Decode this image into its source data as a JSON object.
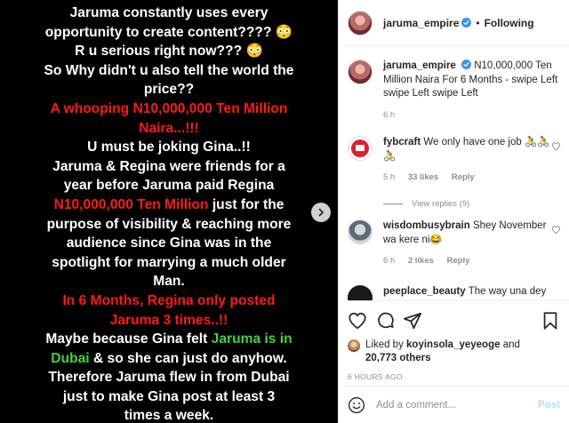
{
  "media": {
    "lines": [
      {
        "segments": [
          {
            "text": "Jaruma constantly uses every",
            "color": "white"
          }
        ]
      },
      {
        "segments": [
          {
            "text": "opportunity to create content???? 😳",
            "color": "white"
          }
        ]
      },
      {
        "segments": [
          {
            "text": "R u serious right now??? 😳",
            "color": "white"
          }
        ]
      },
      {
        "segments": [
          {
            "text": "So Why didn't u also tell the world the",
            "color": "white"
          }
        ]
      },
      {
        "segments": [
          {
            "text": "price??",
            "color": "white"
          }
        ]
      },
      {
        "segments": [
          {
            "text": "A whooping N10,000,000 Ten Million",
            "color": "red"
          }
        ]
      },
      {
        "segments": [
          {
            "text": "Naira...!!!",
            "color": "red"
          }
        ]
      },
      {
        "segments": [
          {
            "text": "U must be joking Gina..!!",
            "color": "white"
          }
        ]
      },
      {
        "segments": [
          {
            "text": "Jaruma & Regina were friends for a",
            "color": "white"
          }
        ]
      },
      {
        "segments": [
          {
            "text": "year before Jaruma paid Regina",
            "color": "white"
          }
        ]
      },
      {
        "segments": [
          {
            "text": "N10,000,000 Ten Million",
            "color": "red"
          },
          {
            "text": " just for the",
            "color": "white"
          }
        ]
      },
      {
        "segments": [
          {
            "text": "purpose of visibility & reaching more",
            "color": "white"
          }
        ]
      },
      {
        "segments": [
          {
            "text": "audience since Gina was in the",
            "color": "white"
          }
        ]
      },
      {
        "segments": [
          {
            "text": "spotlight for marrying a much older",
            "color": "white"
          }
        ]
      },
      {
        "segments": [
          {
            "text": "Man.",
            "color": "white"
          }
        ]
      },
      {
        "segments": [
          {
            "text": "In 6 Months, Regina only posted",
            "color": "red"
          }
        ]
      },
      {
        "segments": [
          {
            "text": "Jaruma 3 times..!!",
            "color": "red"
          }
        ]
      },
      {
        "segments": [
          {
            "text": "Maybe because Gina felt ",
            "color": "white"
          },
          {
            "text": "Jaruma is in",
            "color": "green"
          }
        ]
      },
      {
        "segments": [
          {
            "text": "Dubai",
            "color": "green"
          },
          {
            "text": " & so she can just do anyhow.",
            "color": "white"
          }
        ]
      },
      {
        "segments": [
          {
            "text": "Therefore Jaruma flew in from Dubai",
            "color": "white"
          }
        ]
      },
      {
        "segments": [
          {
            "text": "just to make Gina post at least 3",
            "color": "white"
          }
        ]
      },
      {
        "segments": [
          {
            "text": "times a week.",
            "color": "white"
          }
        ]
      }
    ],
    "colors": {
      "white": "#ffffff",
      "red": "#ff1a1a",
      "green": "#3fd23f"
    }
  },
  "header": {
    "username": "jaruma_empire",
    "separator": "•",
    "follow_label": "Following"
  },
  "caption": {
    "username": "jaruma_empire",
    "text": "N10,000,000 Ten Million Naira For 6 Months - swipe Left swipe Left swipe Left",
    "time": "6 h"
  },
  "comments": [
    {
      "username": "fybcraft",
      "text": "We only have one job 🚴🚴🚴",
      "time": "5 h",
      "likes": "33 likes",
      "reply": "Reply"
    },
    {
      "username": "wisdombusybrain",
      "text": "Shey November wa kere ni😂",
      "time": "6 h",
      "likes": "2 likes",
      "reply": "Reply"
    },
    {
      "username": "peeplace_beauty",
      "text": "The way una dey"
    }
  ],
  "view_replies": "View replies (9)",
  "likes": {
    "prefix": "Liked by ",
    "user": "koyinsola_yeyeoge",
    "and": " and",
    "others": "20,773 others"
  },
  "post_time": "6 HOURS AGO",
  "add_comment": {
    "placeholder": "Add a comment...",
    "post_label": "Post"
  },
  "icons": {
    "verified": "verified-badge-icon",
    "heart": "heart-icon",
    "comment": "comment-bubble-icon",
    "share": "paper-plane-icon",
    "save": "bookmark-icon",
    "emoji": "smiley-icon",
    "next": "chevron-right-icon"
  },
  "accent_colors": {
    "verified_blue": "#3897f0",
    "post_button_disabled": "#b2dffc"
  }
}
